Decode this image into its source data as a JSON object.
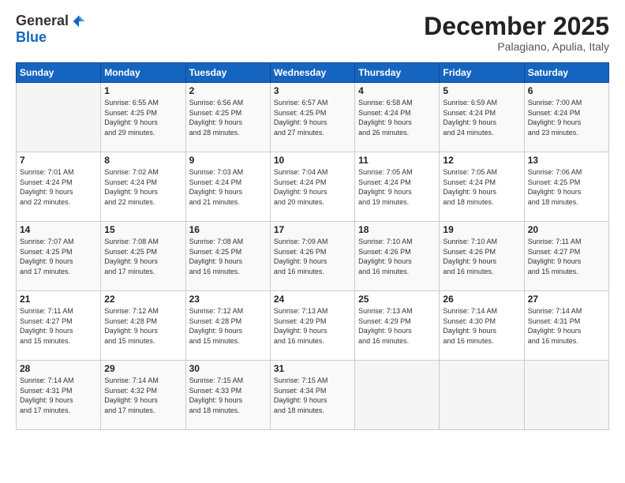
{
  "logo": {
    "general": "General",
    "blue": "Blue"
  },
  "title": "December 2025",
  "subtitle": "Palagiano, Apulia, Italy",
  "days_header": [
    "Sunday",
    "Monday",
    "Tuesday",
    "Wednesday",
    "Thursday",
    "Friday",
    "Saturday"
  ],
  "weeks": [
    [
      {
        "day": "",
        "content": ""
      },
      {
        "day": "1",
        "content": "Sunrise: 6:55 AM\nSunset: 4:25 PM\nDaylight: 9 hours\nand 29 minutes."
      },
      {
        "day": "2",
        "content": "Sunrise: 6:56 AM\nSunset: 4:25 PM\nDaylight: 9 hours\nand 28 minutes."
      },
      {
        "day": "3",
        "content": "Sunrise: 6:57 AM\nSunset: 4:25 PM\nDaylight: 9 hours\nand 27 minutes."
      },
      {
        "day": "4",
        "content": "Sunrise: 6:58 AM\nSunset: 4:24 PM\nDaylight: 9 hours\nand 26 minutes."
      },
      {
        "day": "5",
        "content": "Sunrise: 6:59 AM\nSunset: 4:24 PM\nDaylight: 9 hours\nand 24 minutes."
      },
      {
        "day": "6",
        "content": "Sunrise: 7:00 AM\nSunset: 4:24 PM\nDaylight: 9 hours\nand 23 minutes."
      }
    ],
    [
      {
        "day": "7",
        "content": "Sunrise: 7:01 AM\nSunset: 4:24 PM\nDaylight: 9 hours\nand 22 minutes."
      },
      {
        "day": "8",
        "content": "Sunrise: 7:02 AM\nSunset: 4:24 PM\nDaylight: 9 hours\nand 22 minutes."
      },
      {
        "day": "9",
        "content": "Sunrise: 7:03 AM\nSunset: 4:24 PM\nDaylight: 9 hours\nand 21 minutes."
      },
      {
        "day": "10",
        "content": "Sunrise: 7:04 AM\nSunset: 4:24 PM\nDaylight: 9 hours\nand 20 minutes."
      },
      {
        "day": "11",
        "content": "Sunrise: 7:05 AM\nSunset: 4:24 PM\nDaylight: 9 hours\nand 19 minutes."
      },
      {
        "day": "12",
        "content": "Sunrise: 7:05 AM\nSunset: 4:24 PM\nDaylight: 9 hours\nand 18 minutes."
      },
      {
        "day": "13",
        "content": "Sunrise: 7:06 AM\nSunset: 4:25 PM\nDaylight: 9 hours\nand 18 minutes."
      }
    ],
    [
      {
        "day": "14",
        "content": "Sunrise: 7:07 AM\nSunset: 4:25 PM\nDaylight: 9 hours\nand 17 minutes."
      },
      {
        "day": "15",
        "content": "Sunrise: 7:08 AM\nSunset: 4:25 PM\nDaylight: 9 hours\nand 17 minutes."
      },
      {
        "day": "16",
        "content": "Sunrise: 7:08 AM\nSunset: 4:25 PM\nDaylight: 9 hours\nand 16 minutes."
      },
      {
        "day": "17",
        "content": "Sunrise: 7:09 AM\nSunset: 4:26 PM\nDaylight: 9 hours\nand 16 minutes."
      },
      {
        "day": "18",
        "content": "Sunrise: 7:10 AM\nSunset: 4:26 PM\nDaylight: 9 hours\nand 16 minutes."
      },
      {
        "day": "19",
        "content": "Sunrise: 7:10 AM\nSunset: 4:26 PM\nDaylight: 9 hours\nand 16 minutes."
      },
      {
        "day": "20",
        "content": "Sunrise: 7:11 AM\nSunset: 4:27 PM\nDaylight: 9 hours\nand 15 minutes."
      }
    ],
    [
      {
        "day": "21",
        "content": "Sunrise: 7:11 AM\nSunset: 4:27 PM\nDaylight: 9 hours\nand 15 minutes."
      },
      {
        "day": "22",
        "content": "Sunrise: 7:12 AM\nSunset: 4:28 PM\nDaylight: 9 hours\nand 15 minutes."
      },
      {
        "day": "23",
        "content": "Sunrise: 7:12 AM\nSunset: 4:28 PM\nDaylight: 9 hours\nand 15 minutes."
      },
      {
        "day": "24",
        "content": "Sunrise: 7:13 AM\nSunset: 4:29 PM\nDaylight: 9 hours\nand 16 minutes."
      },
      {
        "day": "25",
        "content": "Sunrise: 7:13 AM\nSunset: 4:29 PM\nDaylight: 9 hours\nand 16 minutes."
      },
      {
        "day": "26",
        "content": "Sunrise: 7:14 AM\nSunset: 4:30 PM\nDaylight: 9 hours\nand 16 minutes."
      },
      {
        "day": "27",
        "content": "Sunrise: 7:14 AM\nSunset: 4:31 PM\nDaylight: 9 hours\nand 16 minutes."
      }
    ],
    [
      {
        "day": "28",
        "content": "Sunrise: 7:14 AM\nSunset: 4:31 PM\nDaylight: 9 hours\nand 17 minutes."
      },
      {
        "day": "29",
        "content": "Sunrise: 7:14 AM\nSunset: 4:32 PM\nDaylight: 9 hours\nand 17 minutes."
      },
      {
        "day": "30",
        "content": "Sunrise: 7:15 AM\nSunset: 4:33 PM\nDaylight: 9 hours\nand 18 minutes."
      },
      {
        "day": "31",
        "content": "Sunrise: 7:15 AM\nSunset: 4:34 PM\nDaylight: 9 hours\nand 18 minutes."
      },
      {
        "day": "",
        "content": ""
      },
      {
        "day": "",
        "content": ""
      },
      {
        "day": "",
        "content": ""
      }
    ]
  ]
}
